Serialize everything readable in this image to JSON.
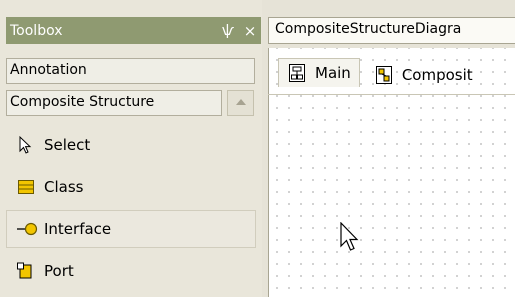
{
  "toolbox": {
    "title": "Toolbox",
    "pin_glyph": "ѱ",
    "close_glyph": "×",
    "groups": [
      {
        "label": "Annotation"
      },
      {
        "label": "Composite Structure"
      }
    ],
    "tools": [
      {
        "label": "Select",
        "icon": "arrow-pointer-icon"
      },
      {
        "label": "Class",
        "icon": "class-icon"
      },
      {
        "label": "Interface",
        "icon": "interface-lollipop-icon",
        "selected": true
      },
      {
        "label": "Port",
        "icon": "port-icon"
      }
    ]
  },
  "document": {
    "tab_title": "CompositeStructureDiagra",
    "view_tabs": [
      {
        "label": "Main",
        "icon": "main-diagram-icon",
        "active": true
      },
      {
        "label": "Composit",
        "icon": "composite-diagram-icon"
      }
    ]
  },
  "colors": {
    "title_bar": "#8f9a71",
    "panel_bg": "#e9e6da",
    "canvas_bg": "#ffffff",
    "grid_dot": "#c6c6c6",
    "class_icon": "#f2c500",
    "interface_icon": "#f2c500"
  }
}
